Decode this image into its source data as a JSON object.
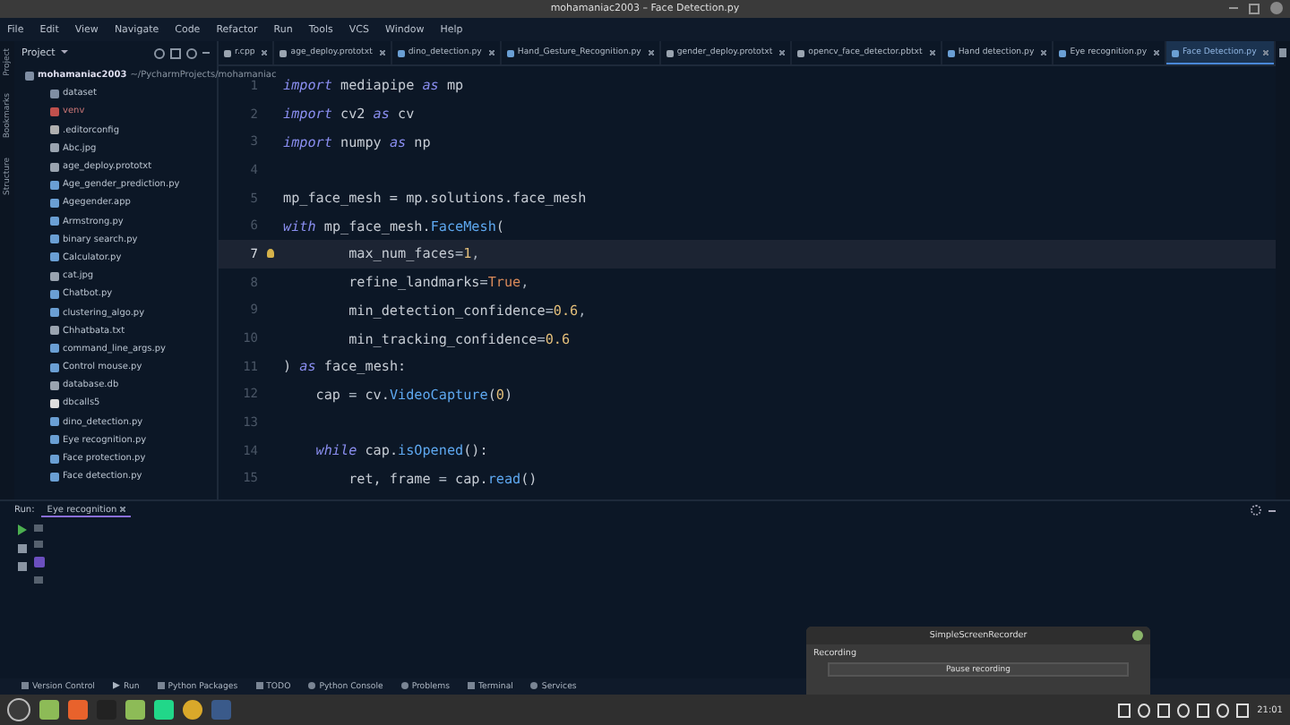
{
  "window": {
    "title": "mohamaniac2003 – Face Detection.py"
  },
  "menu": [
    "File",
    "Edit",
    "View",
    "Navigate",
    "Code",
    "Refactor",
    "Run",
    "Tools",
    "VCS",
    "Window",
    "Help"
  ],
  "side_strip": [
    "Project",
    "Bookmarks",
    "Structure"
  ],
  "project": {
    "title": "Project",
    "root": {
      "name": "mohamaniac2003",
      "path": "~/PycharmProjects/mohamaniac"
    },
    "items": [
      {
        "name": "dataset",
        "kind": "folder"
      },
      {
        "name": "venv",
        "kind": "excluded"
      },
      {
        "name": ".editorconfig",
        "kind": "config"
      },
      {
        "name": "Abc.jpg",
        "kind": "file"
      },
      {
        "name": "age_deploy.prototxt",
        "kind": "file"
      },
      {
        "name": "Age_gender_prediction.py",
        "kind": "py"
      },
      {
        "name": "Agegender.app",
        "kind": "py"
      },
      {
        "name": "Armstrong.py",
        "kind": "py"
      },
      {
        "name": "binary search.py",
        "kind": "py"
      },
      {
        "name": "Calculator.py",
        "kind": "py"
      },
      {
        "name": "cat.jpg",
        "kind": "file"
      },
      {
        "name": "Chatbot.py",
        "kind": "py"
      },
      {
        "name": "clustering_algo.py",
        "kind": "py"
      },
      {
        "name": "Chhatbata.txt",
        "kind": "file"
      },
      {
        "name": "command_line_args.py",
        "kind": "py"
      },
      {
        "name": "Control mouse.py",
        "kind": "py"
      },
      {
        "name": "database.db",
        "kind": "file"
      },
      {
        "name": "dbcalls5",
        "kind": "plain"
      },
      {
        "name": "dino_detection.py",
        "kind": "py"
      },
      {
        "name": "Eye recognition.py",
        "kind": "py"
      },
      {
        "name": "Face protection.py",
        "kind": "py"
      },
      {
        "name": "Face detection.py",
        "kind": "py"
      }
    ]
  },
  "tabs": [
    {
      "label": "r.cpp",
      "kind": "file",
      "selected": false
    },
    {
      "label": "age_deploy.prototxt",
      "kind": "file",
      "selected": false
    },
    {
      "label": "dino_detection.py",
      "kind": "py",
      "selected": false
    },
    {
      "label": "Hand_Gesture_Recognition.py",
      "kind": "py",
      "selected": false
    },
    {
      "label": "gender_deploy.prototxt",
      "kind": "file",
      "selected": false
    },
    {
      "label": "opencv_face_detector.pbtxt",
      "kind": "file",
      "selected": false
    },
    {
      "label": "Hand detection.py",
      "kind": "py",
      "selected": false
    },
    {
      "label": "Eye recognition.py",
      "kind": "py",
      "selected": false
    },
    {
      "label": "Face Detection.py",
      "kind": "py",
      "selected": true
    }
  ],
  "code": [
    {
      "number": "1",
      "current": false,
      "segments": [
        {
          "text": "import",
          "kind": "kw"
        },
        {
          "text": " mediapipe ",
          "kind": "plain"
        },
        {
          "text": "as",
          "kind": "kw"
        },
        {
          "text": " mp",
          "kind": "plain"
        }
      ]
    },
    {
      "number": "2",
      "current": false,
      "segments": [
        {
          "text": "import",
          "kind": "kw"
        },
        {
          "text": " cv2 ",
          "kind": "plain"
        },
        {
          "text": "as",
          "kind": "kw"
        },
        {
          "text": " cv",
          "kind": "plain"
        }
      ]
    },
    {
      "number": "3",
      "current": false,
      "segments": [
        {
          "text": "import",
          "kind": "kw"
        },
        {
          "text": " numpy ",
          "kind": "plain"
        },
        {
          "text": "as",
          "kind": "kw"
        },
        {
          "text": " np",
          "kind": "plain"
        }
      ]
    },
    {
      "number": "4",
      "current": false
    },
    {
      "number": "5",
      "current": false,
      "segments": [
        {
          "text": "mp_face_mesh = mp.solutions.face_mesh",
          "kind": "plain"
        }
      ]
    },
    {
      "number": "6",
      "current": false,
      "segments": [
        {
          "text": "with",
          "kind": "kw"
        },
        {
          "text": " mp_face_mesh.",
          "kind": "plain"
        },
        {
          "text": "FaceMesh",
          "kind": "call"
        },
        {
          "text": "(",
          "kind": "plain"
        }
      ]
    },
    {
      "number": "7",
      "current": true,
      "segments": [
        {
          "text": "        max_num_faces",
          "kind": "plain"
        },
        {
          "text": "=",
          "kind": "punct"
        },
        {
          "text": "1",
          "kind": "num"
        },
        {
          "text": ",",
          "kind": "punct"
        }
      ]
    },
    {
      "number": "8",
      "current": false,
      "segments": [
        {
          "text": "        refine_landmarks",
          "kind": "plain"
        },
        {
          "text": "=",
          "kind": "punct"
        },
        {
          "text": "True",
          "kind": "const"
        },
        {
          "text": ",",
          "kind": "punct"
        }
      ]
    },
    {
      "number": "9",
      "current": false,
      "segments": [
        {
          "text": "        min_detection_confidence",
          "kind": "plain"
        },
        {
          "text": "=",
          "kind": "punct"
        },
        {
          "text": "0.6",
          "kind": "num"
        },
        {
          "text": ",",
          "kind": "punct"
        }
      ]
    },
    {
      "number": "10",
      "current": false,
      "segments": [
        {
          "text": "        min_tracking_confidence",
          "kind": "plain"
        },
        {
          "text": "=",
          "kind": "punct"
        },
        {
          "text": "0.6",
          "kind": "num"
        }
      ]
    },
    {
      "number": "11",
      "current": false,
      "segments": [
        {
          "text": ") ",
          "kind": "plain"
        },
        {
          "text": "as",
          "kind": "kw"
        },
        {
          "text": " face_mesh:",
          "kind": "plain"
        }
      ]
    },
    {
      "number": "12",
      "current": false,
      "segments": [
        {
          "text": "    cap ",
          "kind": "plain"
        },
        {
          "text": "=",
          "kind": "punct"
        },
        {
          "text": " cv.",
          "kind": "plain"
        },
        {
          "text": "VideoCapture",
          "kind": "call"
        },
        {
          "text": "(",
          "kind": "plain"
        },
        {
          "text": "0",
          "kind": "num"
        },
        {
          "text": ")",
          "kind": "plain"
        }
      ]
    },
    {
      "number": "13",
      "current": false
    },
    {
      "number": "14",
      "current": false,
      "segments": [
        {
          "text": "    while",
          "kind": "kw"
        },
        {
          "text": " cap.",
          "kind": "plain"
        },
        {
          "text": "isOpened",
          "kind": "call"
        },
        {
          "text": "():",
          "kind": "plain"
        }
      ]
    },
    {
      "number": "15",
      "current": false,
      "segments": [
        {
          "text": "        ret, frame ",
          "kind": "plain"
        },
        {
          "text": "=",
          "kind": "punct"
        },
        {
          "text": " cap.",
          "kind": "plain"
        },
        {
          "text": "read",
          "kind": "call"
        },
        {
          "text": "()",
          "kind": "plain"
        }
      ]
    }
  ],
  "run_panel": {
    "label": "Run:",
    "tab": "Eye recognition"
  },
  "tool_windows": [
    {
      "label": "Version Control",
      "kind": "vcs"
    },
    {
      "label": "Run",
      "kind": "run"
    },
    {
      "label": "Python Packages",
      "kind": "packages"
    },
    {
      "label": "TODO",
      "kind": "todo"
    },
    {
      "label": "Python Console",
      "kind": "console"
    },
    {
      "label": "Problems",
      "kind": "problems"
    },
    {
      "label": "Terminal",
      "kind": "terminal"
    },
    {
      "label": "Services",
      "kind": "services"
    }
  ],
  "recorder": {
    "title": "SimpleScreenRecorder",
    "section": "Recording",
    "button": "Pause recording"
  },
  "taskbar": {
    "apps": [
      {
        "kind": "menu"
      },
      {
        "kind": "folder"
      },
      {
        "kind": "firefox"
      },
      {
        "kind": "terminal"
      },
      {
        "kind": "folder"
      },
      {
        "kind": "pycharm"
      },
      {
        "kind": "chrome"
      },
      {
        "kind": "recorder"
      }
    ],
    "time": "21:01"
  }
}
